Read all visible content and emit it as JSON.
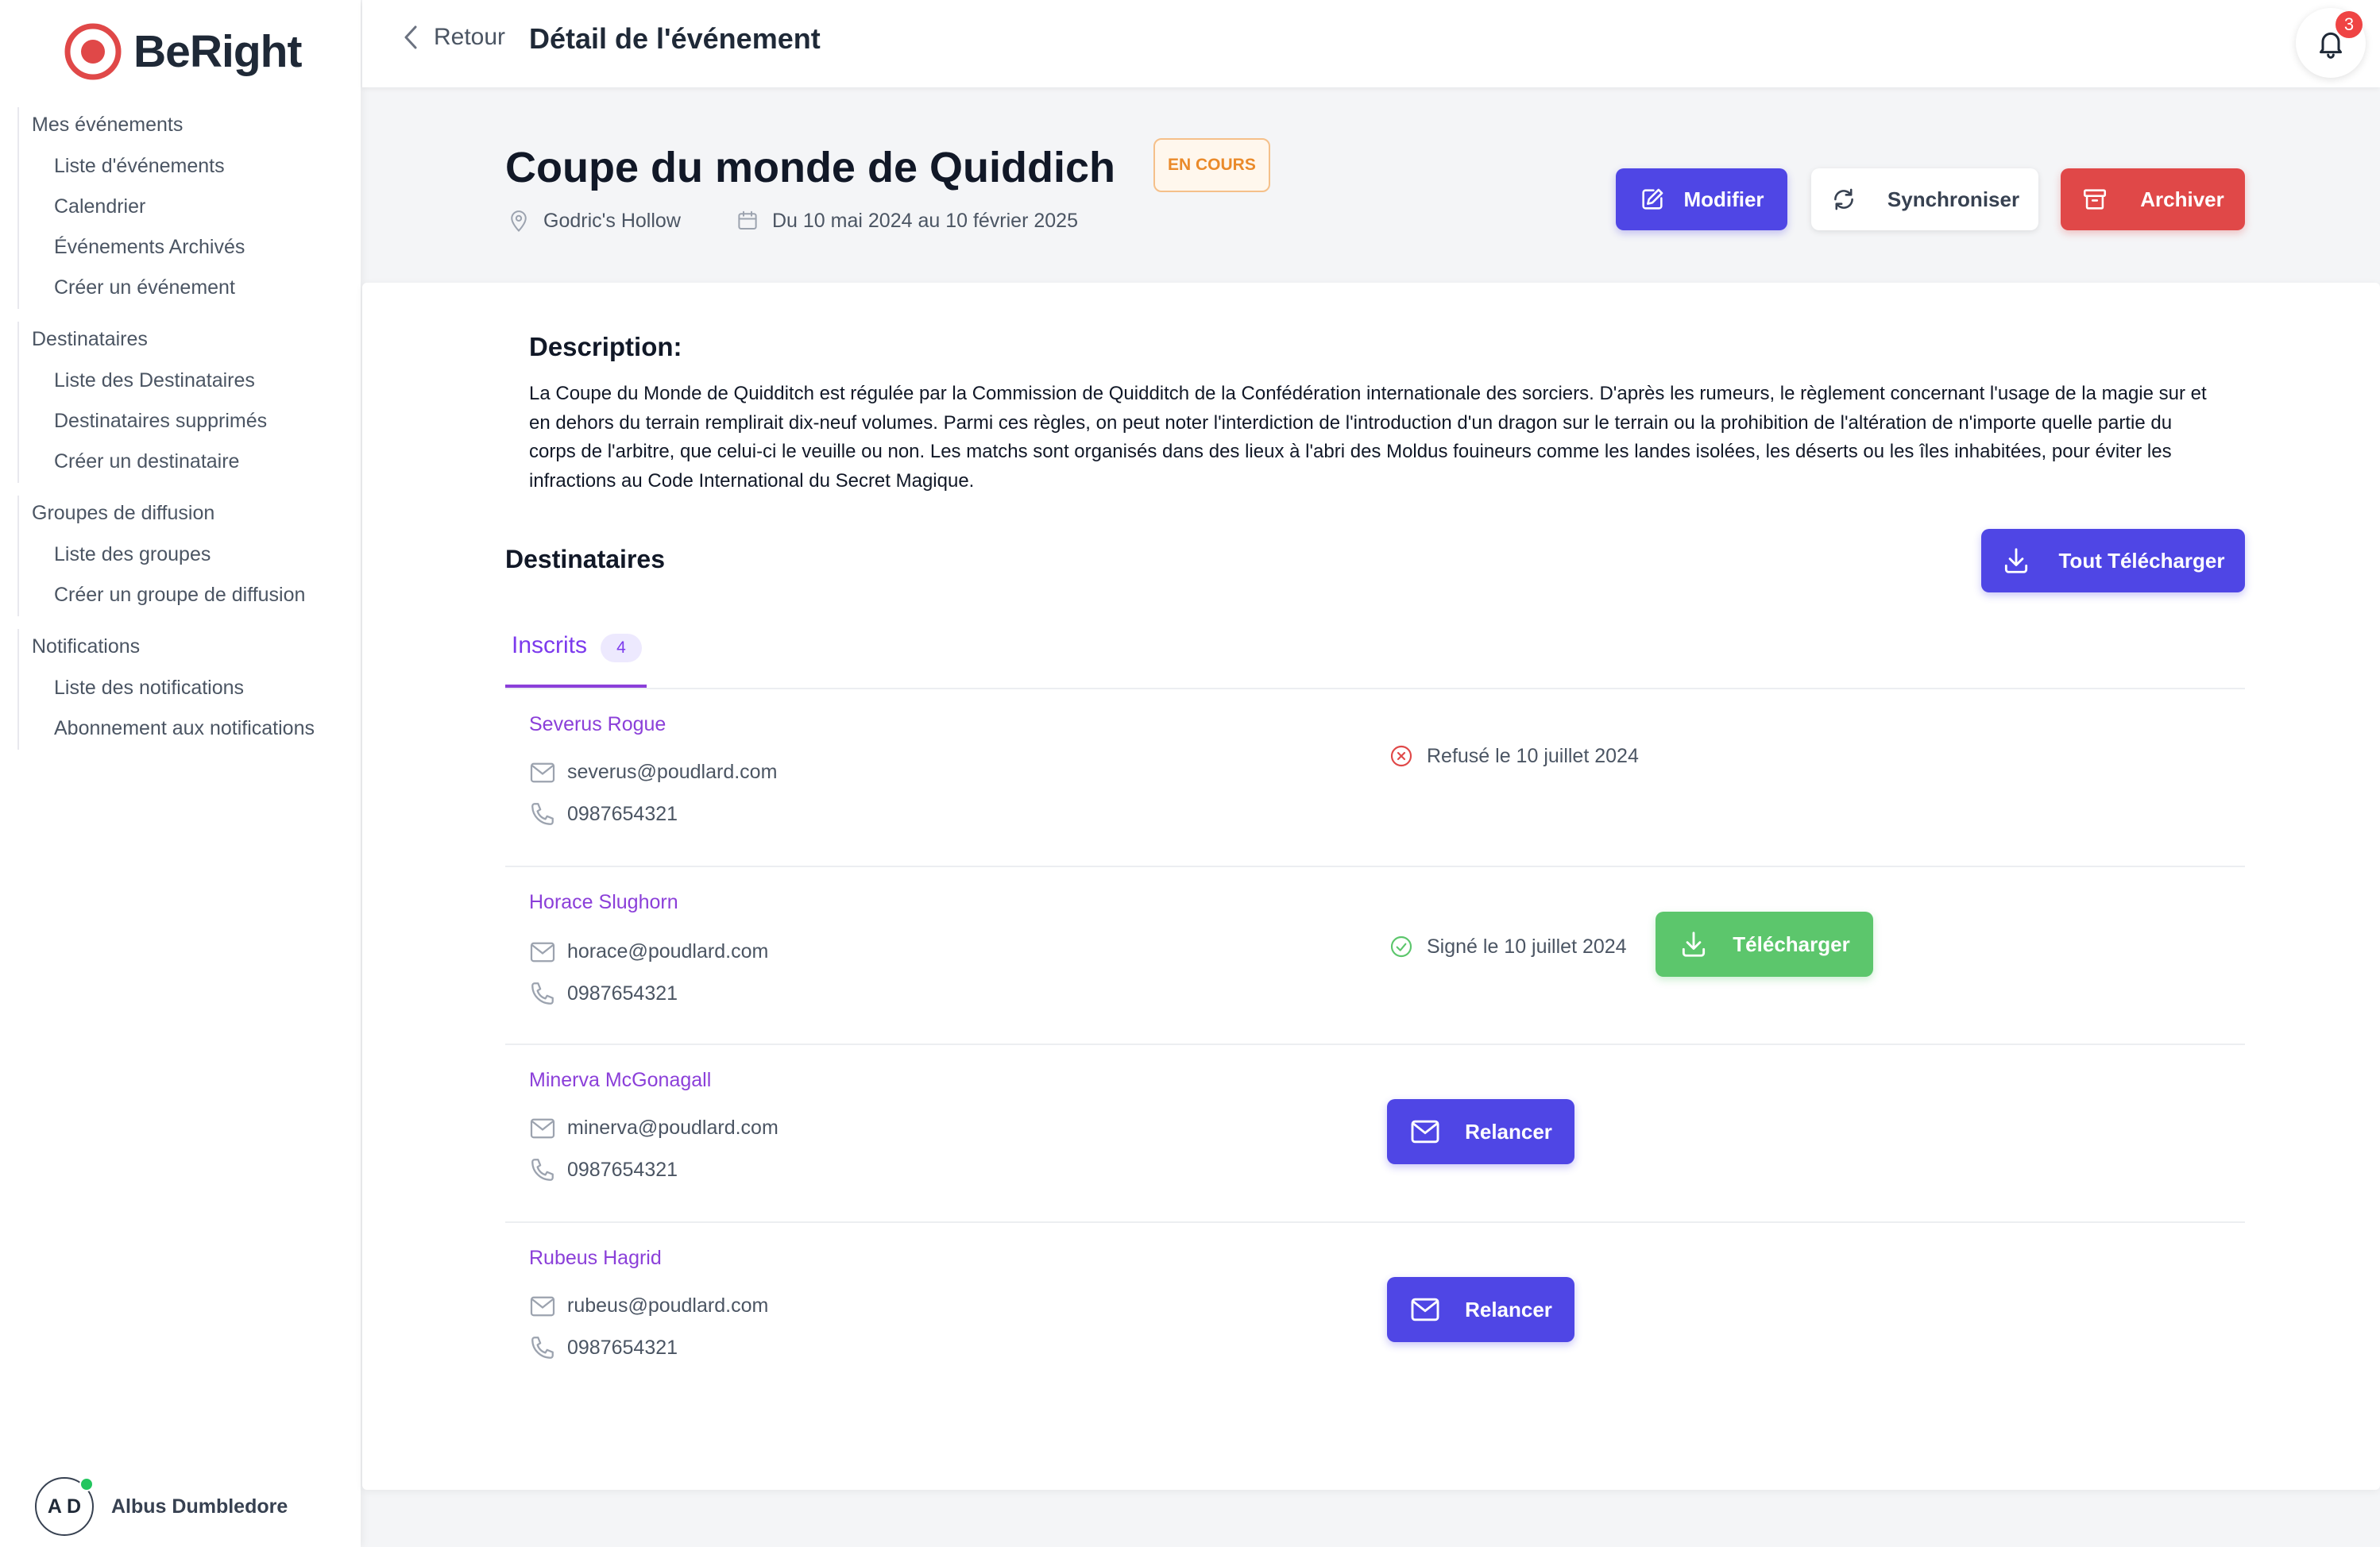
{
  "app": {
    "name": "BeRight",
    "brand_color": "#e04848",
    "accent_color": "#4f46e5"
  },
  "sidebar": {
    "groups": [
      {
        "title": "Mes événements",
        "items": [
          "Liste d'événements",
          "Calendrier",
          "Événements Archivés",
          "Créer un événement"
        ]
      },
      {
        "title": "Destinataires",
        "items": [
          "Liste des Destinataires",
          "Destinataires supprimés",
          "Créer un destinataire"
        ]
      },
      {
        "title": "Groupes de diffusion",
        "items": [
          "Liste des groupes",
          "Créer un groupe de diffusion"
        ]
      },
      {
        "title": "Notifications",
        "items": [
          "Liste des notifications",
          "Abonnement aux notifications"
        ]
      }
    ],
    "user": {
      "initials": "A D",
      "name": "Albus Dumbledore",
      "online": true
    }
  },
  "header": {
    "back_label": "Retour",
    "title": "Détail de l'événement",
    "notifications_count": "3"
  },
  "event": {
    "title": "Coupe du monde de Quiddich",
    "status": "EN COURS",
    "location": "Godric's Hollow",
    "dates": "Du 10 mai 2024 au 10 février 2025",
    "actions": {
      "edit": "Modifier",
      "sync": "Synchroniser",
      "archive": "Archiver"
    },
    "description_title": "Description:",
    "description": "La Coupe du Monde de Quidditch est régulée par la Commission de Quidditch de la Confédération internationale des sorciers. D'après les rumeurs, le règlement concernant l'usage de la magie sur et en dehors du terrain remplirait dix-neuf volumes. Parmi ces règles, on peut noter l'interdiction de l'introduction d'un dragon sur le terrain ou la prohibition de l'altération de n'importe quelle partie du corps de l'arbitre, que celui-ci le veuille ou non. Les matchs sont organisés dans des lieux à l'abri des Moldus fouineurs comme les landes isolées, les déserts ou les îles inhabitées, pour éviter les infractions au Code International du Secret Magique."
  },
  "recipients": {
    "title": "Destinataires",
    "download_all": "Tout Télécharger",
    "tab": {
      "label": "Inscrits",
      "count": "4"
    },
    "rows": [
      {
        "name": "Severus Rogue",
        "email": "severus@poudlard.com",
        "phone": "0987654321",
        "status": "Refusé le 10 juillet 2024",
        "status_type": "refused"
      },
      {
        "name": "Horace Slughorn",
        "email": "horace@poudlard.com",
        "phone": "0987654321",
        "status": "Signé le 10 juillet 2024",
        "status_type": "signed",
        "action": "Télécharger"
      },
      {
        "name": "Minerva McGonagall",
        "email": "minerva@poudlard.com",
        "phone": "0987654321",
        "action": "Relancer"
      },
      {
        "name": "Rubeus Hagrid",
        "email": "rubeus@poudlard.com",
        "phone": "0987654321",
        "action": "Relancer"
      }
    ]
  }
}
